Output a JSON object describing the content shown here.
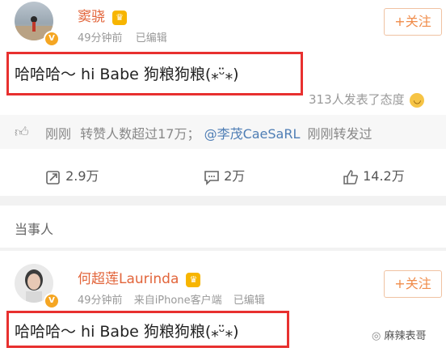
{
  "post1": {
    "username": "窦骁",
    "crown_icon": "crown-badge-icon",
    "time": "49分钟前",
    "edited": "已编辑",
    "follow_label": "+关注",
    "text": "哈哈哈～ hi Babe 狗粮狗粮(⁎ᵕ̈⁎)",
    "attitude": "313人发表了态度",
    "repost_notice": {
      "time": "刚刚",
      "text": "转赞人数超过17万；",
      "mention": "@李茂CaeSaRL",
      "suffix": "刚刚转发过"
    },
    "actions": {
      "repost": "2.9万",
      "comment": "2万",
      "like": "14.2万"
    }
  },
  "section_label": "当事人",
  "post2": {
    "username": "何超莲Laurinda",
    "time": "49分钟前",
    "source": "来自iPhone客户端",
    "edited": "已编辑",
    "follow_label": "+关注",
    "text": "哈哈哈～ hi Babe 狗粮狗粮(⁎ᵕ̈⁎)"
  },
  "watermark": "麻辣表哥",
  "colors": {
    "username": "#e2653b",
    "highlight_box": "#e8302f",
    "follow": "#f08c4a",
    "link": "#4f7eb5"
  }
}
